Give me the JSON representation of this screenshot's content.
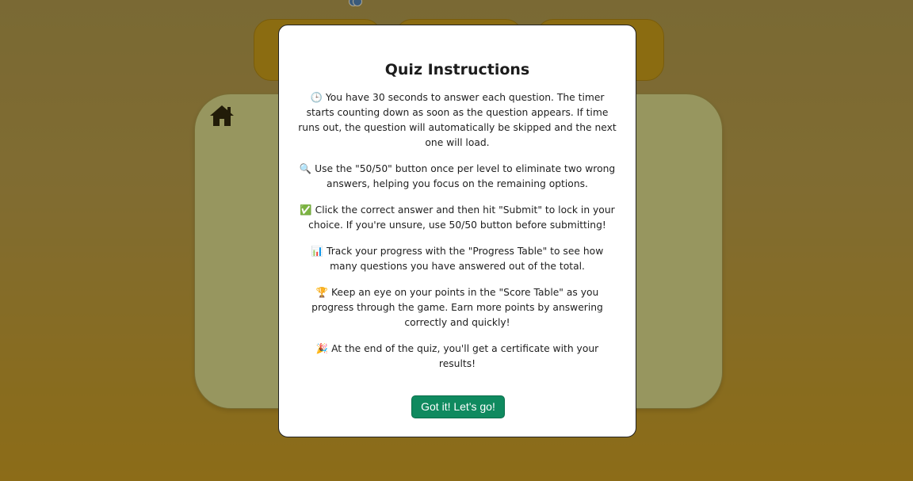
{
  "modal": {
    "title": "Quiz Instructions",
    "instructions": [
      {
        "icon": "🕒",
        "icon_name": "clock-icon",
        "text": "You have 30 seconds to answer each question. The timer starts counting down as soon as the question appears. If time runs out, the question will automatically be skipped and the next one will load."
      },
      {
        "icon": "🔍",
        "icon_name": "magnifier-icon",
        "text": "Use the \"50/50\" button once per level to eliminate two wrong answers, helping you focus on the remaining options."
      },
      {
        "icon": "✅",
        "icon_name": "check-icon",
        "text": "Click the correct answer and then hit \"Submit\" to lock in your choice. If you're unsure, use 50/50 button before submitting!"
      },
      {
        "icon": "📊",
        "icon_name": "bar-chart-icon",
        "text": "Track your progress with the \"Progress Table\" to see how many questions you have answered out of the total."
      },
      {
        "icon": "🏆",
        "icon_name": "trophy-icon",
        "text": "Keep an eye on your points in the \"Score Table\" as you progress through the game. Earn more points by answering correctly and quickly!"
      },
      {
        "icon": "🎉",
        "icon_name": "party-icon",
        "text": "At the end of the quiz, you'll get a certificate with your results!"
      }
    ],
    "confirm_label": "Got it! Let's go!"
  },
  "colors": {
    "confirm_button": "#0f8a5f",
    "quiz_card": "#d9e2a4",
    "stat_box": "#c49a1e"
  }
}
